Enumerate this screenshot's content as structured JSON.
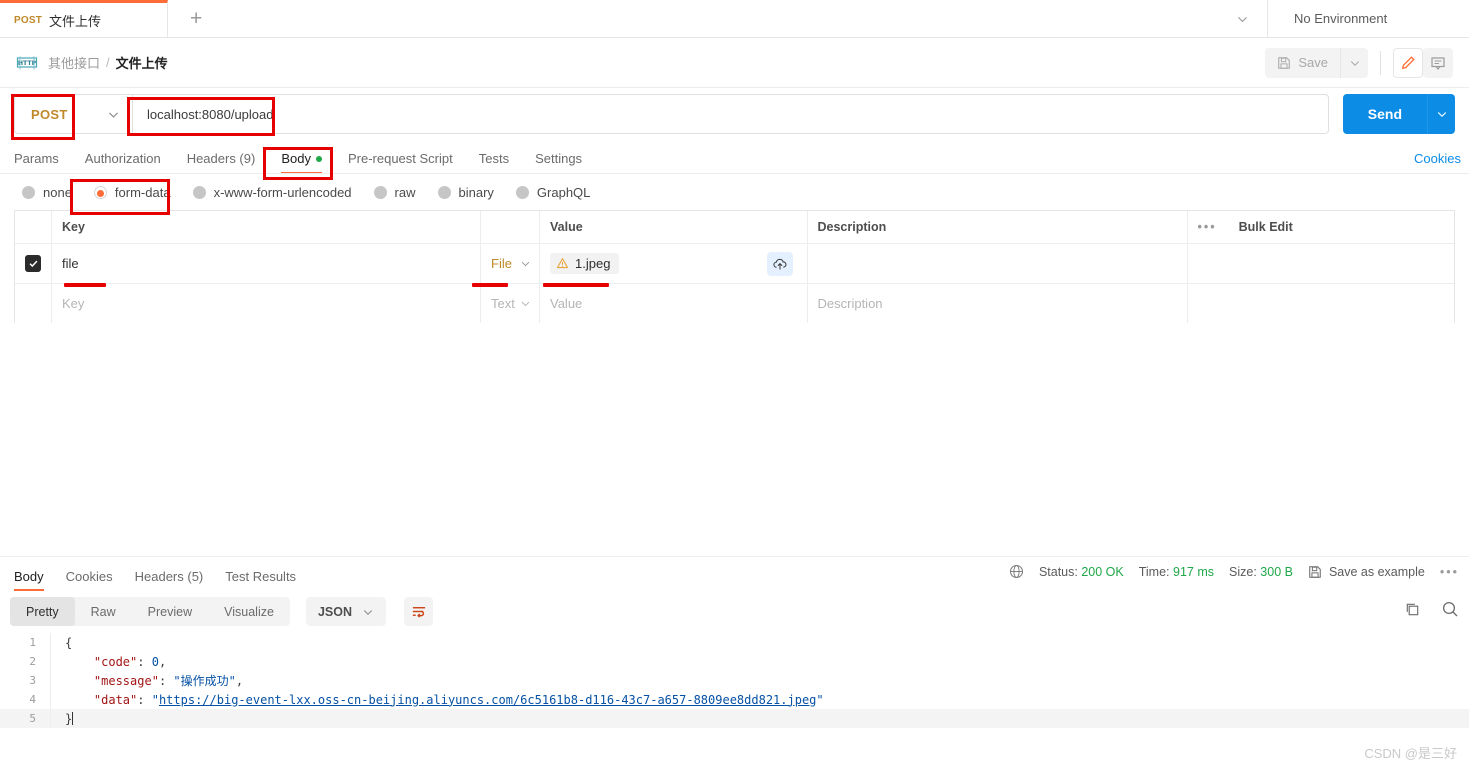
{
  "tabbar": {
    "request_tab": {
      "method": "POST",
      "name": "文件上传"
    },
    "new_tab_label": "+",
    "environment": "No Environment"
  },
  "breadcrumb": {
    "icon": "http-icon",
    "collection": "其他接口",
    "separator": "/",
    "current": "文件上传",
    "save_label": "Save",
    "save_icon": "floppy-disk-icon",
    "save_caret_icon": "chevron-down-icon",
    "edit_icon": "pencil-icon",
    "comment_icon": "comment-icon"
  },
  "request": {
    "method": "POST",
    "method_caret_icon": "chevron-down-icon",
    "url": "localhost:8080/upload",
    "send_label": "Send",
    "send_caret_icon": "chevron-down-icon",
    "tabs": [
      {
        "label": "Params",
        "active": false
      },
      {
        "label": "Authorization",
        "active": false
      },
      {
        "label": "Headers (9)",
        "active": false
      },
      {
        "label": "Body",
        "active": true,
        "dot": true
      },
      {
        "label": "Pre-request Script",
        "active": false
      },
      {
        "label": "Tests",
        "active": false
      },
      {
        "label": "Settings",
        "active": false
      }
    ],
    "cookies_link": "Cookies",
    "body_types": [
      {
        "label": "none",
        "selected": false
      },
      {
        "label": "form-data",
        "selected": true
      },
      {
        "label": "x-www-form-urlencoded",
        "selected": false
      },
      {
        "label": "raw",
        "selected": false
      },
      {
        "label": "binary",
        "selected": false
      },
      {
        "label": "GraphQL",
        "selected": false
      }
    ],
    "table": {
      "headers": {
        "key": "Key",
        "value": "Value",
        "description": "Description",
        "bulk_edit": "Bulk Edit",
        "more_icon": "ellipsis-icon"
      },
      "rows": [
        {
          "checked": true,
          "key": "file",
          "type": "File",
          "type_caret_icon": "chevron-down-icon",
          "value": "1.jpeg",
          "value_warning_icon": "warning-triangle-icon",
          "upload_icon": "cloud-upload-icon",
          "description": ""
        }
      ],
      "placeholder_row": {
        "key_placeholder": "Key",
        "type": "Text",
        "type_caret_icon": "chevron-down-icon",
        "value_placeholder": "Value",
        "description_placeholder": "Description"
      }
    }
  },
  "response": {
    "tabs": [
      {
        "label": "Body",
        "active": true
      },
      {
        "label": "Cookies",
        "active": false
      },
      {
        "label": "Headers (5)",
        "active": false
      },
      {
        "label": "Test Results",
        "active": false
      }
    ],
    "meta": {
      "globe_icon": "globe-icon",
      "status_label": "Status:",
      "status_value": "200 OK",
      "time_label": "Time:",
      "time_value": "917 ms",
      "size_label": "Size:",
      "size_value": "300 B",
      "save_example_icon": "floppy-disk-icon",
      "save_example_label": "Save as example",
      "overflow_icon": "ellipsis-icon"
    },
    "formats": [
      {
        "label": "Pretty",
        "active": true
      },
      {
        "label": "Raw",
        "active": false
      },
      {
        "label": "Preview",
        "active": false
      },
      {
        "label": "Visualize",
        "active": false
      }
    ],
    "language": "JSON",
    "language_caret_icon": "chevron-down-icon",
    "wrap_icon": "wrap-text-icon",
    "copy_icon": "copy-icon",
    "search_icon": "search-icon",
    "body_lines": [
      {
        "n": "1",
        "content": "{"
      },
      {
        "n": "2",
        "content": "    \"code\": 0,"
      },
      {
        "n": "3",
        "content": "    \"message\": \"操作成功\","
      },
      {
        "n": "4",
        "content": "    \"data\": \"https://big-event-lxx.oss-cn-beijing.aliyuncs.com/6c5161b8-d116-43c7-a657-8809ee8dd821.jpeg\""
      },
      {
        "n": "5",
        "content": "}"
      }
    ],
    "body_json": {
      "code": 0,
      "message": "操作成功",
      "data": "https://big-event-lxx.oss-cn-beijing.aliyuncs.com/6c5161b8-d116-43c7-a657-8809ee8dd821.jpeg"
    },
    "line_numbers": [
      "1",
      "2",
      "3",
      "4",
      "5"
    ],
    "code_tokens": {
      "key_code": "\"code\"",
      "val_code": "0",
      "key_message": "\"message\"",
      "val_message": "\"操作成功\"",
      "key_data": "\"data\"",
      "val_data_url": "https://big-event-lxx.oss-cn-beijing.aliyuncs.com/6c5161b8-d116-43c7-a657-8809ee8dd821.jpeg",
      "brace_open": "{",
      "brace_close": "}",
      "colon": ": ",
      "comma": ",",
      "quote": "\""
    }
  },
  "watermark": "CSDN @是三好",
  "colors": {
    "accent_orange": "#ff6c37",
    "send_blue": "#0d8ce6",
    "status_green": "#1ea847",
    "annotation_red": "#e60000",
    "method_amber": "#c0892a"
  }
}
